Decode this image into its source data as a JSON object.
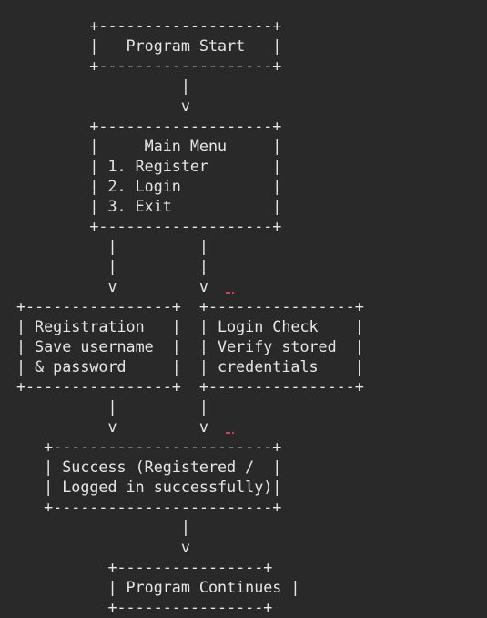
{
  "diagram": {
    "lines": [
      "        +-------------------+",
      "        |   Program Start   |",
      "        +-------------------+",
      "                  |",
      "                  v",
      "        +-------------------+",
      "        |     Main Menu     |",
      "        | 1. Register       |",
      "        | 2. Login          |",
      "        | 3. Exit           |",
      "        +-------------------+",
      "          |         |",
      "          |         |",
      "          v         v",
      "+----------------+  +----------------+",
      "| Registration   |  | Login Check    |",
      "| Save username  |  | Verify stored  |",
      "| & password     |  | credentials    |",
      "+----------------+  +----------------+",
      "          |         |",
      "          v         v",
      "   +------------------------+",
      "   | Success (Registered /  |",
      "   | Logged in successfully)|",
      "   +------------------------+",
      "                  |",
      "                  v",
      "          +----------------+",
      "          | Program Continues |",
      "          +----------------+"
    ]
  }
}
